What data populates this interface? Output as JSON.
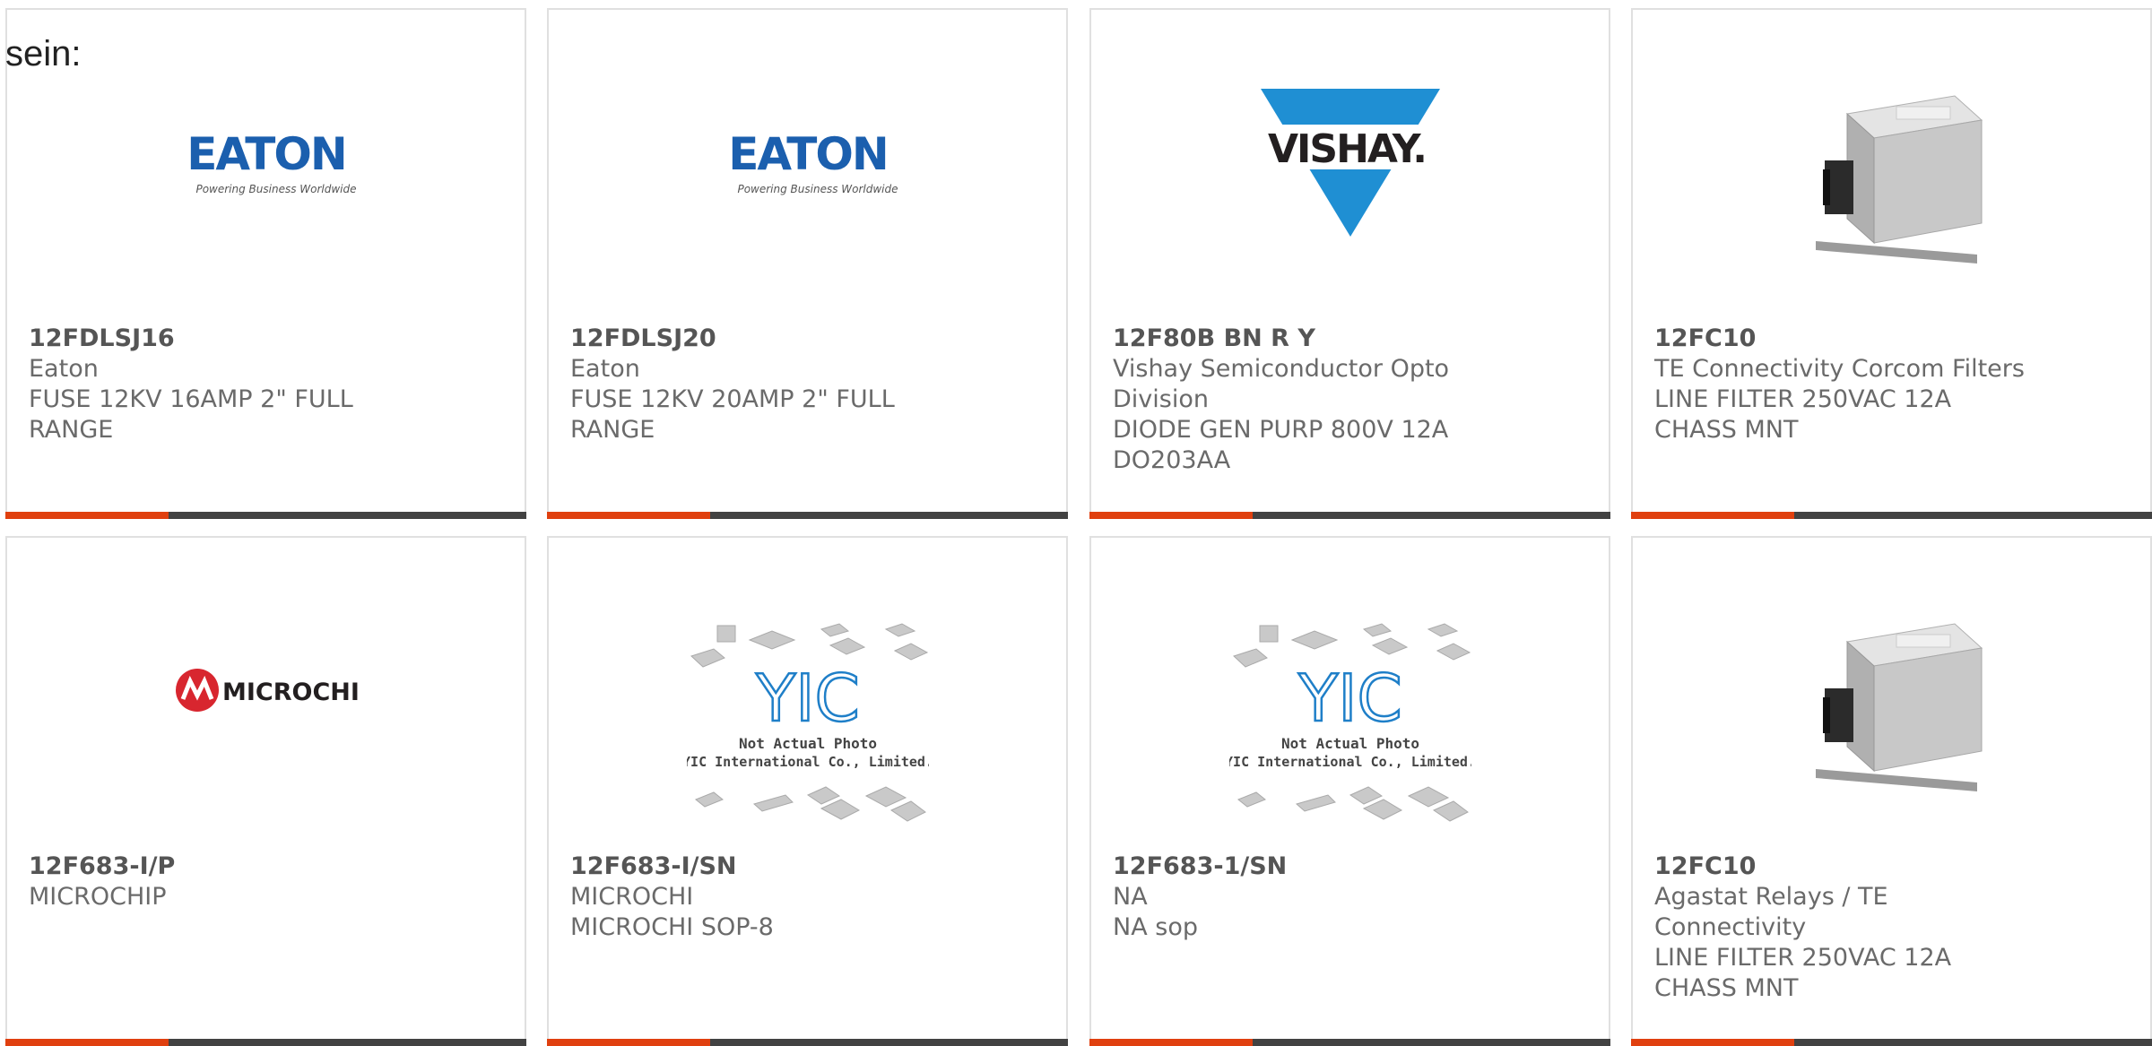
{
  "intro": {
    "text": "sein:"
  },
  "colors": {
    "accent": "#e0400f",
    "bar": "#424242",
    "border": "#e0e0e0",
    "text": "#6a6a6a"
  },
  "products": [
    {
      "part_number": "12FDLSJ16",
      "manufacturer": "Eaton",
      "description": "FUSE 12KV 16AMP 2\" FULL RANGE",
      "image": "eaton-logo",
      "logo_text": "EATON",
      "logo_tagline": "Powering Business Worldwide"
    },
    {
      "part_number": "12FDLSJ20",
      "manufacturer": "Eaton",
      "description": "FUSE 12KV 20AMP 2\" FULL RANGE",
      "image": "eaton-logo",
      "logo_text": "EATON",
      "logo_tagline": "Powering Business Worldwide"
    },
    {
      "part_number": "12F80B BN R Y",
      "manufacturer": "Vishay Semiconductor Opto Division",
      "description": "DIODE GEN PURP 800V 12A DO203AA",
      "image": "vishay-logo",
      "logo_text": "VISHAY."
    },
    {
      "part_number": "12FC10",
      "manufacturer": "TE Connectivity Corcom Filters",
      "description": "LINE FILTER 250VAC 12A CHASS MNT",
      "image": "line-filter-photo"
    },
    {
      "part_number": "12F683-I/P",
      "manufacturer": "MICROCHIP",
      "description": "",
      "image": "microchip-logo",
      "logo_text": "MICROCHIP"
    },
    {
      "part_number": "12F683-I/SN",
      "manufacturer": "MICROCHI",
      "description": "MICROCHI SOP-8",
      "image": "not-actual-photo",
      "logo_text": "YIC",
      "placeholder_line1": "Not Actual Photo",
      "placeholder_line2": "YIC International Co., Limited."
    },
    {
      "part_number": "12F683-1/SN",
      "manufacturer": "NA",
      "description": "NA sop",
      "image": "not-actual-photo",
      "logo_text": "YIC",
      "placeholder_line1": "Not Actual Photo",
      "placeholder_line2": "YIC International Co., Limited."
    },
    {
      "part_number": "12FC10",
      "manufacturer": "Agastat Relays / TE Connectivity",
      "description": "LINE FILTER 250VAC 12A CHASS MNT",
      "image": "line-filter-photo"
    }
  ]
}
